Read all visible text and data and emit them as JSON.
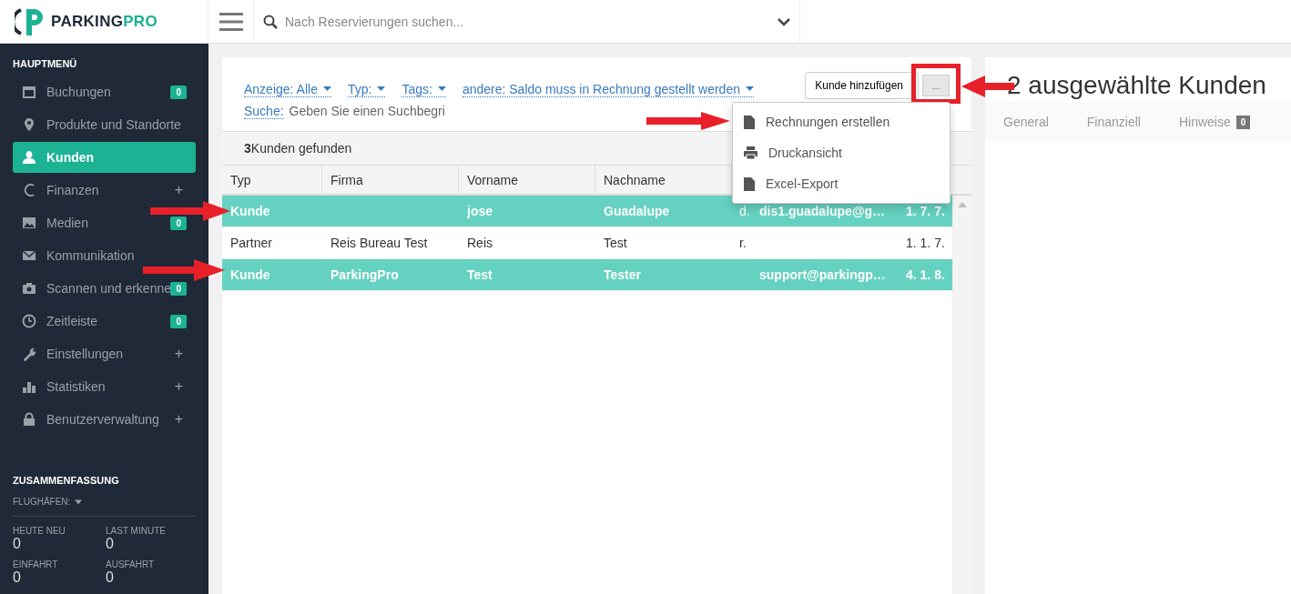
{
  "logo": {
    "first": "PARKING",
    "second": "PRO"
  },
  "search": {
    "placeholder": "Nach Reservierungen suchen..."
  },
  "sidebar": {
    "heading": "HAUPTMENÜ",
    "items": [
      {
        "label": "Buchungen",
        "badge": "0",
        "selected": false
      },
      {
        "label": "Produkte und Standorte",
        "selected": false
      },
      {
        "label": "Kunden",
        "selected": true
      },
      {
        "label": "Finanzen",
        "trailing": "+",
        "selected": false
      },
      {
        "label": "Medien",
        "badge": "0",
        "selected": false
      },
      {
        "label": "Kommunikation",
        "selected": false
      },
      {
        "label": "Scannen und erkenne",
        "badge": "0",
        "selected": false
      },
      {
        "label": "Zeitleiste",
        "badge": "0",
        "selected": false
      },
      {
        "label": "Einstellungen",
        "trailing": "+",
        "selected": false
      },
      {
        "label": "Statistiken",
        "trailing": "+",
        "selected": false
      },
      {
        "label": "Benutzerverwaltung",
        "trailing": "+",
        "selected": false
      }
    ]
  },
  "summary": {
    "heading": "ZUSAMMENFASSUNG",
    "airports": "FLUGHÄFEN:",
    "stats": [
      {
        "label": "HEUTE NEU",
        "value": "0"
      },
      {
        "label": "LAST MINUTE",
        "value": "0"
      },
      {
        "label": "EINFAHRT",
        "value": "0"
      },
      {
        "label": "AUSFAHRT",
        "value": "0"
      }
    ]
  },
  "filters": [
    "Anzeige: Alle",
    "Typ:",
    "Tags:",
    "andere: Saldo muss in Rechnung gestellt werden"
  ],
  "search_filter": {
    "label": "Suche:",
    "placeholder": "Geben Sie einen Suchbegri"
  },
  "add_button": "Kunde hinzufügen",
  "more_button": "...",
  "menu": [
    "Rechnungen erstellen",
    "Druckansicht",
    "Excel-Export"
  ],
  "result": {
    "count": "3",
    "text": "Kunden gefunden"
  },
  "table": {
    "columns": [
      "Typ",
      "Firma",
      "Vorname",
      "Nachname"
    ],
    "rows": [
      {
        "selected": true,
        "cells": [
          "Kunde",
          "",
          "jose",
          "Guadalupe",
          "d.",
          "dis1.guadalupe@g…",
          "1. 7. 7."
        ]
      },
      {
        "selected": false,
        "cells": [
          "Partner",
          "Reis Bureau Test",
          "Reis",
          "Test",
          "r.",
          "",
          "1. 1. 7."
        ]
      },
      {
        "selected": true,
        "cells": [
          "Kunde",
          "ParkingPro",
          "Test",
          "Tester",
          "",
          "support@parkingp…",
          "4. 1. 8."
        ]
      }
    ]
  },
  "detail": {
    "title": "2 ausgewählte Kunden",
    "tabs": [
      {
        "label": "General"
      },
      {
        "label": "Finanziell"
      },
      {
        "label": "Hinweise",
        "badge": "0"
      }
    ]
  }
}
